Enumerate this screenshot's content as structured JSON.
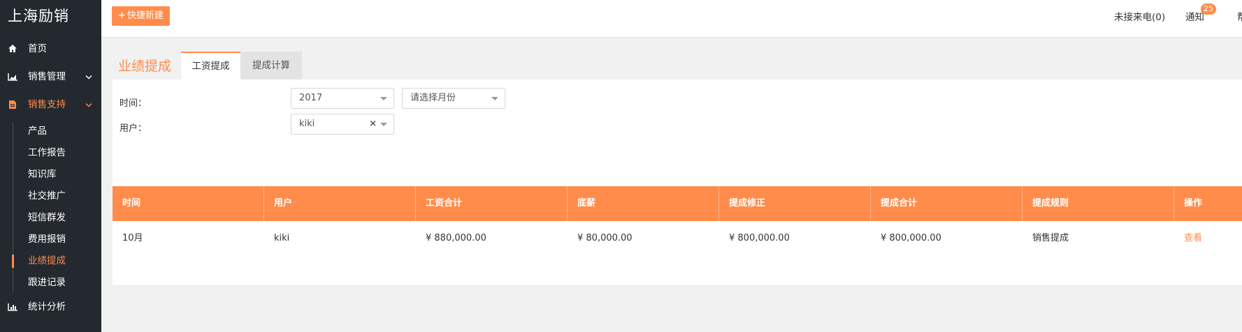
{
  "brand": "上海励销",
  "sidebar": {
    "items": [
      {
        "label": "首页",
        "icon": "home-icon"
      },
      {
        "label": "销售管理",
        "icon": "area-chart-icon"
      },
      {
        "label": "销售支持",
        "icon": "file-icon"
      }
    ],
    "sub_items": [
      "产品",
      "工作报告",
      "知识库",
      "社交推广",
      "短信群发",
      "费用报销",
      "业绩提成",
      "跟进记录"
    ],
    "bottom_item": {
      "label": "统计分析",
      "icon": "bar-chart-icon"
    },
    "chevron": "⌄"
  },
  "header": {
    "quick_new": "快捷新建",
    "quick_icon": "+",
    "missed_calls": "未接来电(0)",
    "notify": "通知",
    "notify_count": "25",
    "edge": "帮"
  },
  "page": {
    "title": "业绩提成",
    "tabs": [
      "工资提成",
      "提成计算"
    ]
  },
  "filters": {
    "time_label": "时间：",
    "year_value": "2017",
    "month_placeholder": "请选择月份",
    "user_label": "用户：",
    "user_value": "kiki",
    "clear": "×"
  },
  "table": {
    "columns": [
      "时间",
      "用户",
      "工资合计",
      "底薪",
      "提成修正",
      "提成合计",
      "提成规则",
      "操作"
    ],
    "rows": [
      [
        "10月",
        "kiki",
        "¥ 880,000.00",
        "¥ 80,000.00",
        "¥ 800,000.00",
        "¥ 800,000.00",
        "销售提成",
        "查看"
      ]
    ]
  },
  "colors": {
    "accent": "#ff8c4b",
    "sidebar_bg": "#24292f"
  }
}
